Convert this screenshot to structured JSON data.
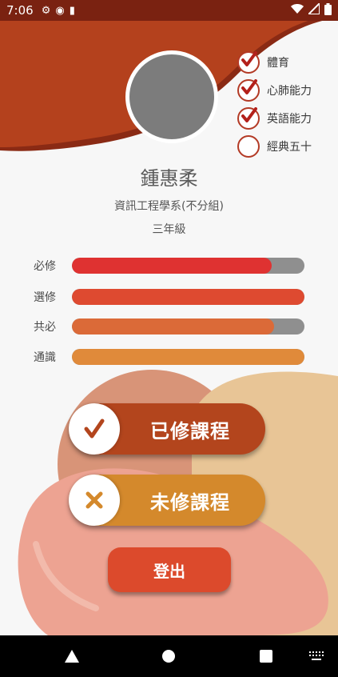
{
  "status_bar": {
    "time": "7:06"
  },
  "profile": {
    "name": "鍾惠柔",
    "department": "資訊工程學系(不分組)",
    "grade": "三年級"
  },
  "checklist": [
    {
      "label": "體育",
      "checked": true
    },
    {
      "label": "心肺能力",
      "checked": true
    },
    {
      "label": "英語能力",
      "checked": true
    },
    {
      "label": "經典五十",
      "checked": false
    }
  ],
  "progress": [
    {
      "label": "必修",
      "fraction": 0.86,
      "color": "#df3231"
    },
    {
      "label": "選修",
      "fraction": 1.0,
      "color": "#de4a30"
    },
    {
      "label": "共必",
      "fraction": 0.87,
      "color": "#db6a38"
    },
    {
      "label": "通識",
      "fraction": 1.0,
      "color": "#e08a3a"
    }
  ],
  "buttons": {
    "completed_courses": "已修課程",
    "incomplete_courses": "未修課程",
    "logout": "登出"
  },
  "colors": {
    "status_bar": "#7a2211",
    "header_wave": "#b4411d",
    "completed_button": "#b3451d",
    "incomplete_button": "#d4892c",
    "logout_button": "#dc4a2c"
  }
}
